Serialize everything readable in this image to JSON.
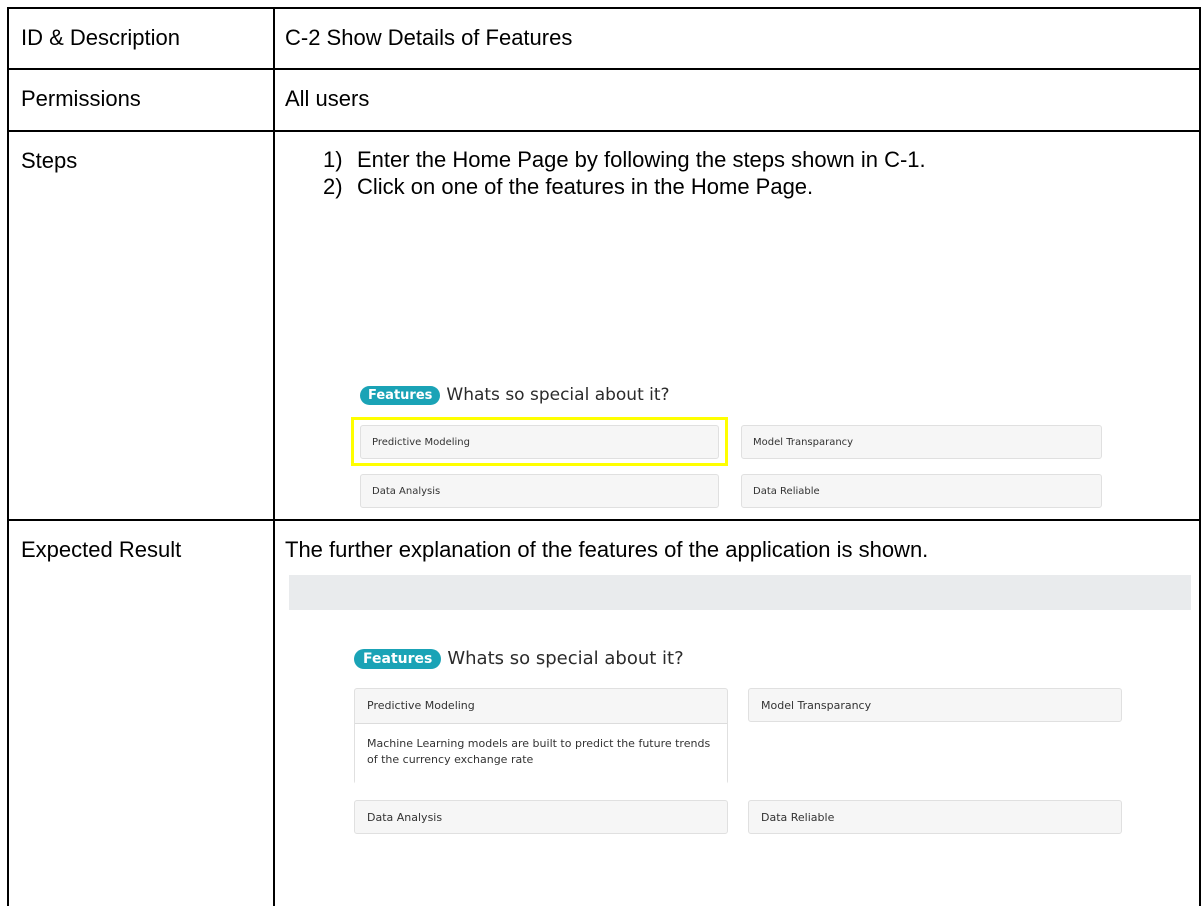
{
  "table": {
    "rows": [
      {
        "label": "ID & Description",
        "value": "C-2 Show Details of Features"
      },
      {
        "label": "Permissions",
        "value": "All users"
      },
      {
        "label": "Steps"
      },
      {
        "label": "Expected Result",
        "value": "The further explanation of the features of the application is shown."
      }
    ]
  },
  "steps": [
    {
      "num": "1)",
      "text": "Enter the Home Page by following the steps shown in C-1."
    },
    {
      "num": "2)",
      "text": "Click on one of the features in the Home Page."
    }
  ],
  "features_section": {
    "badge": "Features",
    "heading": "Whats so special about it?",
    "cards": [
      "Predictive Modeling",
      "Model Transparancy",
      "Data Analysis",
      "Data Reliable"
    ],
    "expanded_description": "Machine Learning models are built to predict the future trends of the currency exchange rate"
  },
  "colors": {
    "badge": "#1aa3b6",
    "highlight": "#ffff00",
    "card_bg": "#f6f6f6"
  }
}
